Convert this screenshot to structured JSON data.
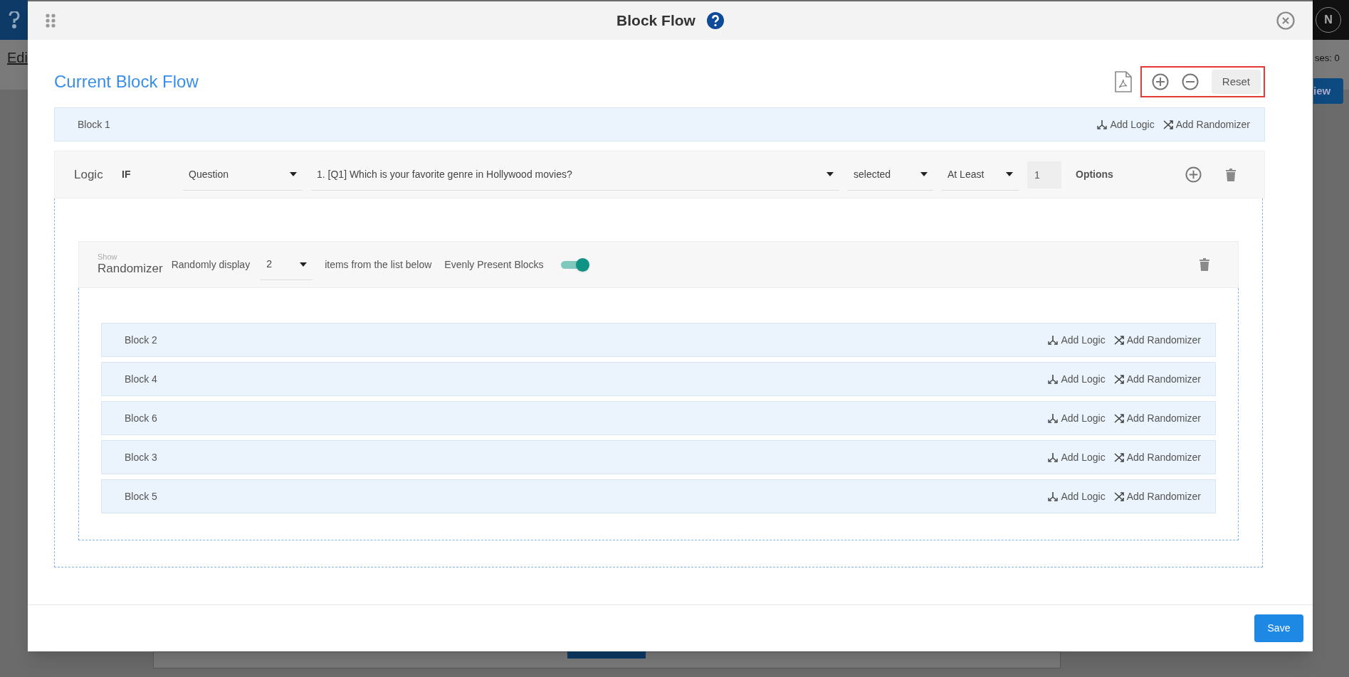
{
  "background": {
    "menu_text": "Edi",
    "counter_text": "ses: 0",
    "button_text": "iew",
    "avatar": "N"
  },
  "dialog": {
    "title": "Block Flow",
    "heading": "Current Block Flow",
    "reset_label": "Reset",
    "highlight_zoom_controls": true,
    "top_block": {
      "name": "Block 1",
      "actions": [
        "Add Logic",
        "Add Randomizer"
      ]
    },
    "logic": {
      "label": "Logic",
      "keyword": "IF",
      "source": "Question",
      "question": "1. [Q1] Which is your favorite genre in Hollywood movies?",
      "condition": "selected",
      "quantifier": "At Least",
      "count": "1",
      "unit": "Options"
    },
    "randomizer": {
      "caption": "Show",
      "label": "Randomizer",
      "prefix": "Randomly display",
      "count": "2",
      "suffix": "items from the list below",
      "evenly_label": "Evenly Present Blocks",
      "evenly_on": true,
      "blocks": [
        {
          "name": "Block 2",
          "actions": [
            "Add Logic",
            "Add Randomizer"
          ]
        },
        {
          "name": "Block 4",
          "actions": [
            "Add Logic",
            "Add Randomizer"
          ]
        },
        {
          "name": "Block 6",
          "actions": [
            "Add Logic",
            "Add Randomizer"
          ]
        },
        {
          "name": "Block 3",
          "actions": [
            "Add Logic",
            "Add Randomizer"
          ]
        },
        {
          "name": "Block 5",
          "actions": [
            "Add Logic",
            "Add Randomizer"
          ]
        }
      ]
    },
    "save_label": "Save"
  }
}
